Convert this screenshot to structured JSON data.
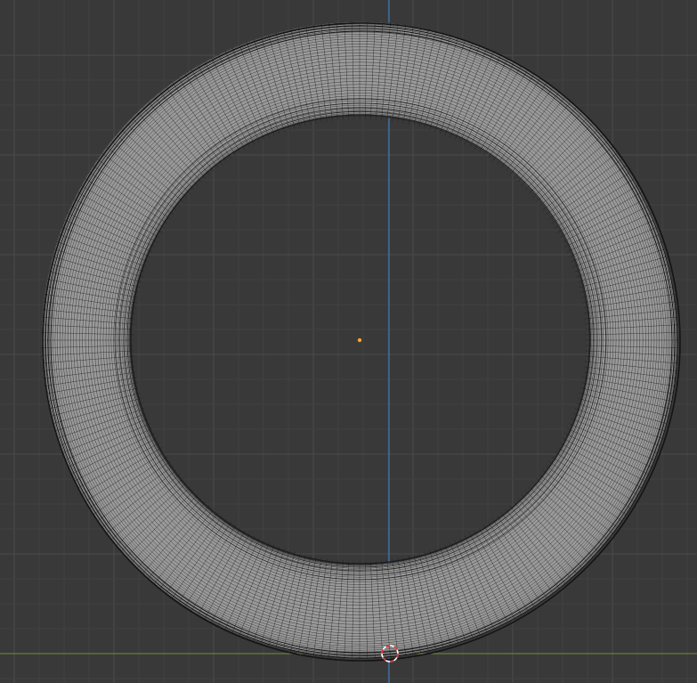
{
  "viewport": {
    "background_color": "#393939",
    "grid_minor_color": "#414141",
    "grid_major_color": "#4a4a4a",
    "axis_y_color": "#3f6fa6",
    "axis_x_color": "#6f8f3a"
  },
  "mesh": {
    "object_type": "torus",
    "shading": "solid-gray",
    "face_color": "#9a9a9a",
    "wire_color": "#1e1e1e",
    "outline_color": "#141414"
  },
  "origin_point": {
    "color": "#f5a030"
  },
  "cursor_3d": {
    "icon": "3d-cursor-icon",
    "colors": [
      "#e03030",
      "#ffffff"
    ]
  }
}
